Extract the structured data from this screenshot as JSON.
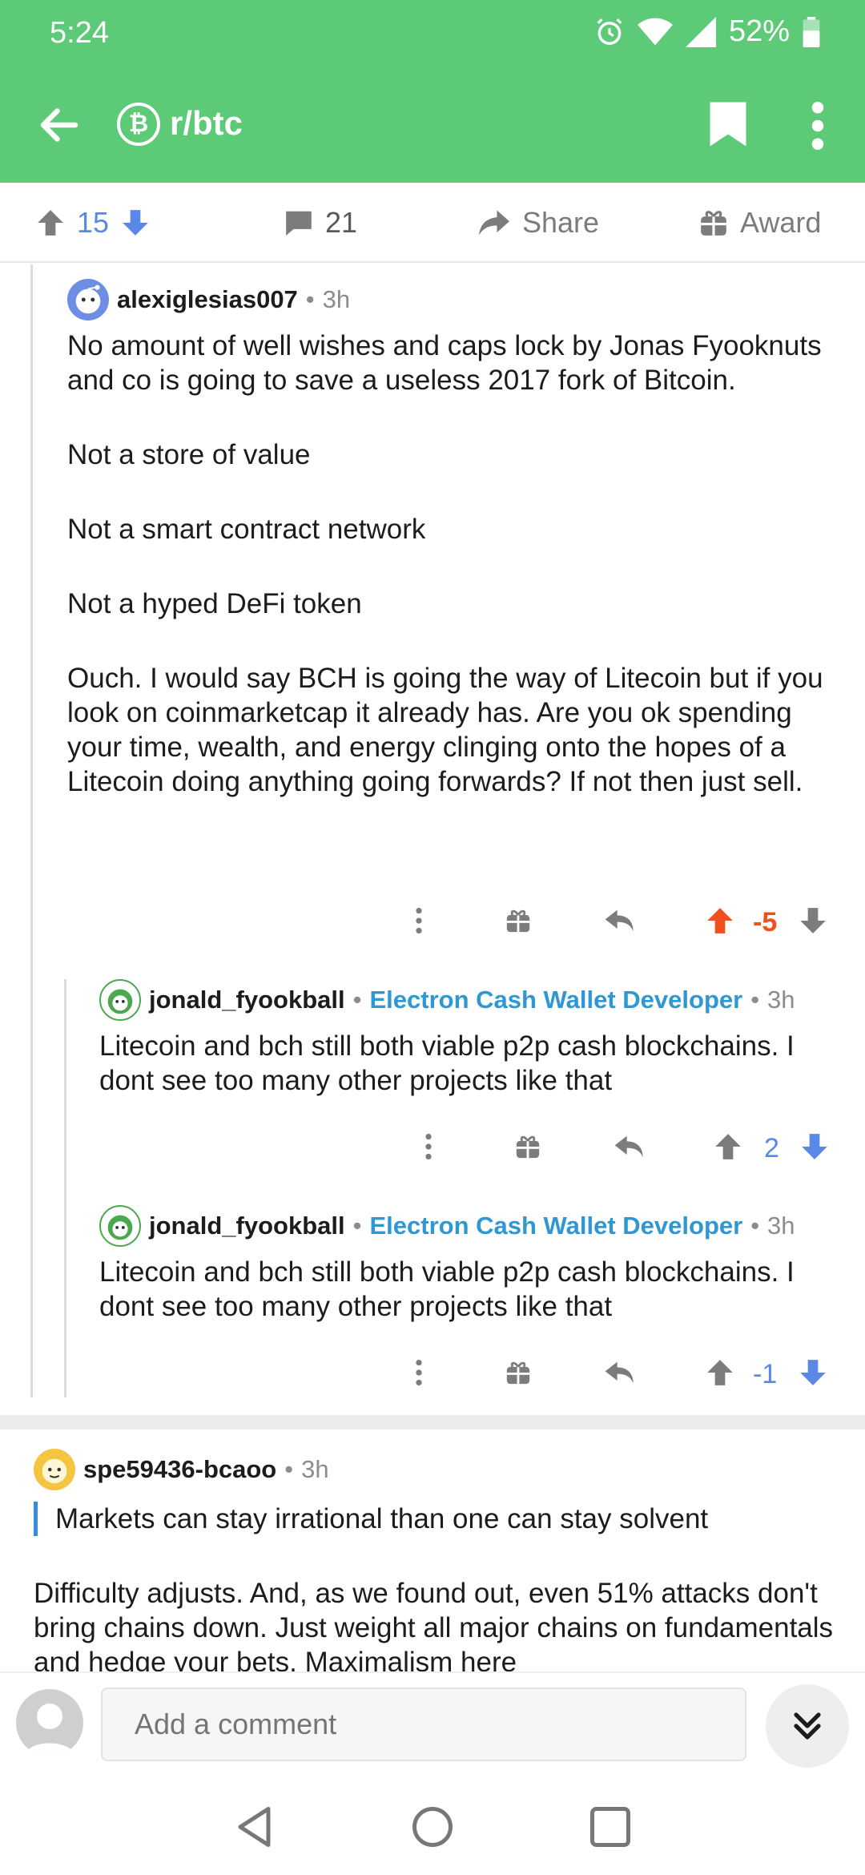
{
  "status_bar": {
    "time": "5:24",
    "battery": "52%"
  },
  "app_bar": {
    "subreddit": "r/btc",
    "sub_icon_glyph": "₿",
    "icons": [
      "back-arrow-icon",
      "bitcoin-icon",
      "bookmark-icon",
      "more-vertical-icon"
    ]
  },
  "post_actions": {
    "score": "15",
    "comments": "21",
    "share_label": "Share",
    "award_label": "Award"
  },
  "comments": [
    {
      "username": "alexiglesias007",
      "age": "3h",
      "paragraphs": [
        "No amount of well wishes and caps lock by Jonas Fyooknuts and co is going to save a useless 2017 fork of Bitcoin.",
        "Not a store of value",
        "Not a smart contract network",
        "Not a hyped DeFi token",
        "Ouch. I would say BCH is going the way of Litecoin but if you look on coinmarketcap it already has. Are you ok spending your time, wealth, and energy clinging onto the hopes of a Litecoin doing anything going forwards? If not then just sell."
      ],
      "score": "-5",
      "vote_state": "upvoted"
    },
    {
      "username": "jonald_fyookball",
      "flair": "Electron Cash Wallet Developer",
      "age": "3h",
      "text": "Litecoin and bch still both viable p2p cash blockchains. I dont see too many other projects like that",
      "score": "2"
    },
    {
      "username": "jonald_fyookball",
      "flair": "Electron Cash Wallet Developer",
      "age": "3h",
      "text": "Litecoin and bch still both viable p2p cash blockchains. I dont see too many other projects like that",
      "score": "-1"
    },
    {
      "username": "spe59436-bcaoo",
      "age": "3h",
      "quote": "Markets can stay irrational than one can stay solvent",
      "text": "Difficulty adjusts. And, as we found out, even 51% attacks don't bring chains down. Just weight all major chains on fundamentals and hedge your bets. Maximalism here"
    }
  ],
  "composer": {
    "placeholder": "Add a comment"
  },
  "colors": {
    "brand_green": "#5dca78",
    "upvote_orange": "#f0501e",
    "vote_blue": "#5b88e6",
    "flair_blue": "#2f97d4"
  }
}
